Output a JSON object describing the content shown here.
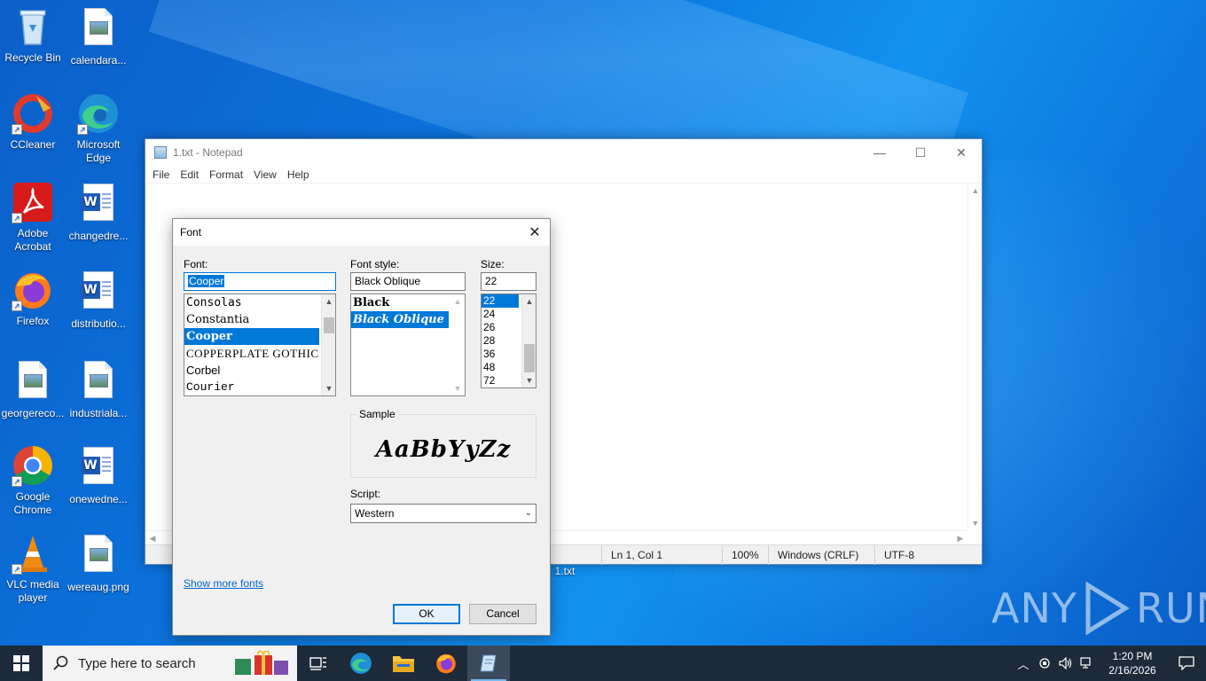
{
  "desktop": {
    "icons": [
      {
        "label": "Recycle Bin"
      },
      {
        "label": "calendara..."
      },
      {
        "label": "CCleaner"
      },
      {
        "label": "Microsoft Edge"
      },
      {
        "label": "Adobe Acrobat"
      },
      {
        "label": "changedre..."
      },
      {
        "label": "Firefox"
      },
      {
        "label": "distributio..."
      },
      {
        "label": "georgereco..."
      },
      {
        "label": "industriala..."
      },
      {
        "label": "Google Chrome"
      },
      {
        "label": "onewedne..."
      },
      {
        "label": "VLC media player"
      },
      {
        "label": "wereaug.png"
      },
      {
        "label": "1.txt"
      }
    ],
    "watermark": {
      "left": "ANY",
      "right": "RUN"
    }
  },
  "notepad": {
    "title": "1.txt - Notepad",
    "menu": [
      "File",
      "Edit",
      "Format",
      "View",
      "Help"
    ],
    "status": {
      "position": "Ln 1, Col 1",
      "zoom": "100%",
      "line_ending": "Windows (CRLF)",
      "encoding": "UTF-8"
    }
  },
  "font_dialog": {
    "title": "Font",
    "font_label": "Font:",
    "font_value": "Cooper",
    "fonts": [
      "Consolas",
      "Constantia",
      "Cooper",
      "COPPERPLATE GOTHIC",
      "Corbel",
      "Courier"
    ],
    "selected_font": "Cooper",
    "style_label": "Font style:",
    "style_value": "Black Oblique",
    "styles": [
      "Black",
      "Black Oblique"
    ],
    "selected_style": "Black Oblique",
    "size_label": "Size:",
    "size_value": "22",
    "sizes": [
      "22",
      "24",
      "26",
      "28",
      "36",
      "48",
      "72"
    ],
    "selected_size": "22",
    "sample_label": "Sample",
    "sample_text": "AaBbYyZz",
    "script_label": "Script:",
    "script_value": "Western",
    "more_fonts_link": "Show more fonts",
    "ok_label": "OK",
    "cancel_label": "Cancel"
  },
  "taskbar": {
    "search_placeholder": "Type here to search",
    "time": "1:20 PM",
    "date": "2/16/2026"
  },
  "colors": {
    "accent": "#0078d7",
    "taskbar": "#1c2a3a",
    "desktop": "#0b73dc"
  }
}
